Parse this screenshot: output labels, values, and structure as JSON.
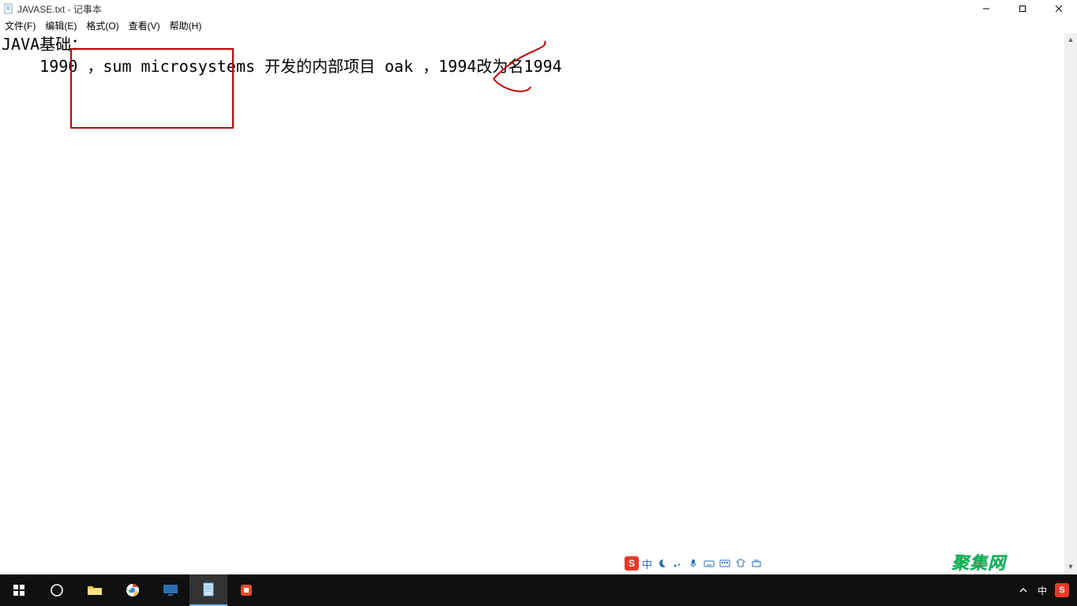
{
  "titlebar": {
    "icon_name": "notepad-icon",
    "title": "JAVASE.txt - 记事本"
  },
  "menubar": {
    "items": [
      {
        "label": "文件(F)"
      },
      {
        "label": "编辑(E)"
      },
      {
        "label": "格式(O)"
      },
      {
        "label": "查看(V)"
      },
      {
        "label": "帮助(H)"
      }
    ]
  },
  "editor": {
    "line1": "JAVA基础：",
    "line2": "    1990 ，sum microsystems 开发的内部项目 oak ，1994改为名1994"
  },
  "ime": {
    "logo_letter": "S",
    "mode_text": "中",
    "icons": [
      "moon-icon",
      "punct-icon",
      "mic-icon",
      "keyboard-icon",
      "soft-keyboard-icon",
      "clothes-icon",
      "toolbox-icon"
    ]
  },
  "watermark": {
    "text": "聚集网"
  },
  "taskbar": {
    "start_icon": "windows-start-icon",
    "cortana_icon": "cortana-circle-icon",
    "apps": [
      {
        "name": "file-explorer-icon",
        "color": "#f7c948"
      },
      {
        "name": "chrome-icon",
        "color": "#ffffff"
      },
      {
        "name": "monitor-app-icon",
        "color": "#2a6fb5"
      },
      {
        "name": "notepad-app-icon",
        "color": "#6db2e2",
        "active": true
      },
      {
        "name": "recorder-app-icon",
        "color": "#e84f2e"
      }
    ],
    "tray": {
      "chevron": "chevron-up-icon",
      "ime_text": "中",
      "sogou_letter": "S"
    }
  }
}
